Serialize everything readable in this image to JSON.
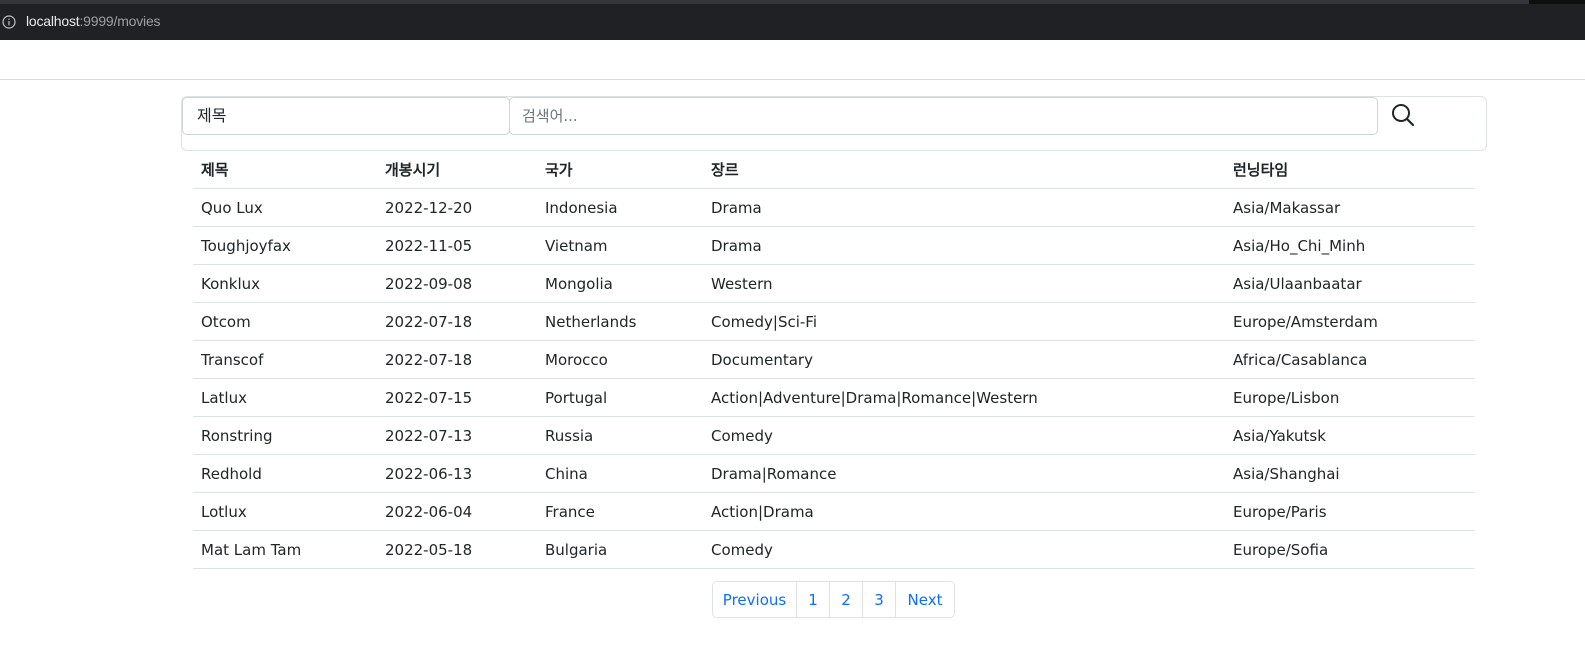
{
  "browser": {
    "url_host": "localhost",
    "url_rest": ":9999/movies"
  },
  "search": {
    "field_selected": "제목",
    "placeholder": "검색어..."
  },
  "table": {
    "headers": [
      "제목",
      "개봉시기",
      "국가",
      "장르",
      "런닝타임"
    ],
    "rows": [
      [
        "Quo Lux",
        "2022-12-20",
        "Indonesia",
        "Drama",
        "Asia/Makassar"
      ],
      [
        "Toughjoyfax",
        "2022-11-05",
        "Vietnam",
        "Drama",
        "Asia/Ho_Chi_Minh"
      ],
      [
        "Konklux",
        "2022-09-08",
        "Mongolia",
        "Western",
        "Asia/Ulaanbaatar"
      ],
      [
        "Otcom",
        "2022-07-18",
        "Netherlands",
        "Comedy|Sci-Fi",
        "Europe/Amsterdam"
      ],
      [
        "Transcof",
        "2022-07-18",
        "Morocco",
        "Documentary",
        "Africa/Casablanca"
      ],
      [
        "Latlux",
        "2022-07-15",
        "Portugal",
        "Action|Adventure|Drama|Romance|Western",
        "Europe/Lisbon"
      ],
      [
        "Ronstring",
        "2022-07-13",
        "Russia",
        "Comedy",
        "Asia/Yakutsk"
      ],
      [
        "Redhold",
        "2022-06-13",
        "China",
        "Drama|Romance",
        "Asia/Shanghai"
      ],
      [
        "Lotlux",
        "2022-06-04",
        "France",
        "Action|Drama",
        "Europe/Paris"
      ],
      [
        "Mat Lam Tam",
        "2022-05-18",
        "Bulgaria",
        "Comedy",
        "Europe/Sofia"
      ]
    ]
  },
  "pagination": {
    "previous": "Previous",
    "pages": [
      "1",
      "2",
      "3"
    ],
    "next": "Next"
  },
  "colors": {
    "link": "#0d6efd",
    "browser_bar": "#202124"
  },
  "icons": {
    "info": "info-icon",
    "search": "search-icon"
  }
}
